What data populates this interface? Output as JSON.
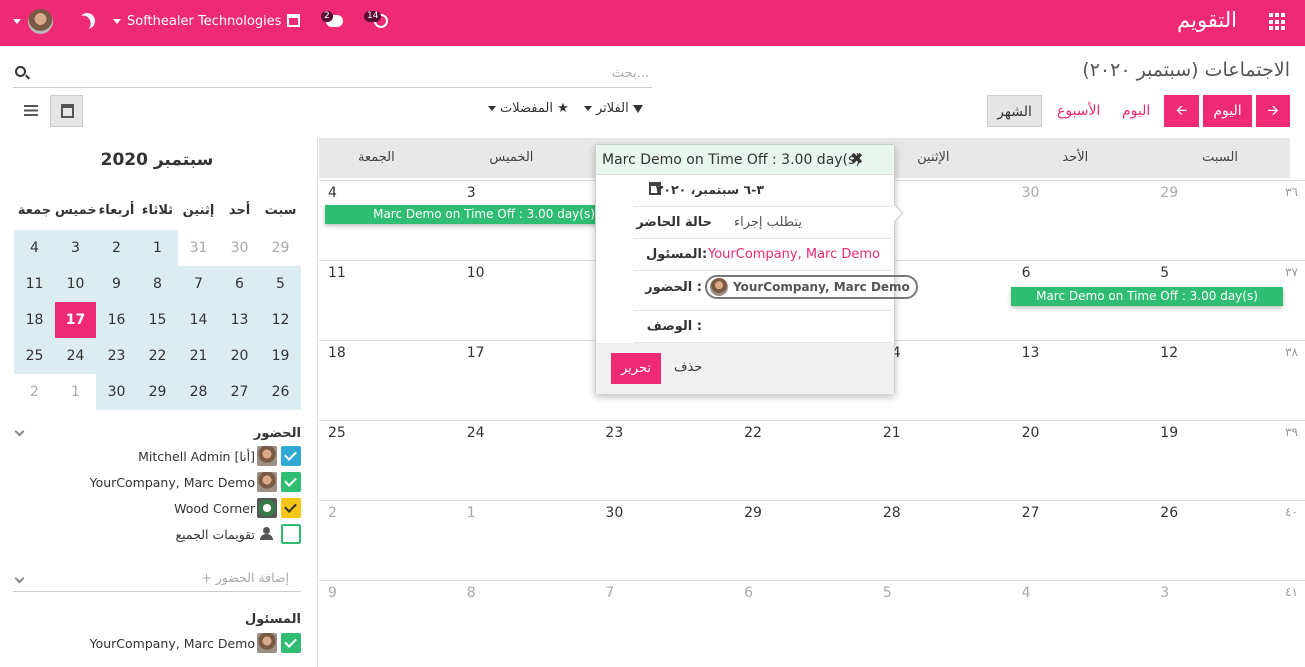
{
  "topbar": {
    "app_title": "التقويم",
    "company": "Softhealer Technologies",
    "chat_badge": "2",
    "activity_badge": "14",
    "icons": [
      "apps-grid-icon",
      "gift-icon",
      "chat-icon",
      "clock-icon",
      "moon-icon"
    ]
  },
  "breadcrumb": "الاجتماعات (سبتمبر ٢٠٢٠)",
  "search": {
    "placeholder": "بحث..."
  },
  "filters": {
    "filters_label": "الفلاتر",
    "favorites_label": "المفضلات"
  },
  "pager": {
    "today_label": "اليوم"
  },
  "scales": {
    "day": "اليوم",
    "week": "الأسبوع",
    "month": "الشهر"
  },
  "mini_calendar": {
    "title": "سبتمبر 2020",
    "weekdays": [
      "سبت",
      "أحد",
      "إثنين",
      "ثلاثاء",
      "أربعاء",
      "خميس",
      "جمعة"
    ],
    "weeks": [
      [
        "29",
        "30",
        "31",
        "1",
        "2",
        "3",
        "4"
      ],
      [
        "5",
        "6",
        "7",
        "8",
        "9",
        "10",
        "11"
      ],
      [
        "12",
        "13",
        "14",
        "15",
        "16",
        "17",
        "18"
      ],
      [
        "19",
        "20",
        "21",
        "22",
        "23",
        "24",
        "25"
      ],
      [
        "26",
        "27",
        "28",
        "29",
        "30",
        "1",
        "2"
      ]
    ],
    "today": "17"
  },
  "attendees": {
    "title": "الحضور",
    "items": [
      {
        "label": "Mitchell Admin [أنا]",
        "color": "#30a9d4"
      },
      {
        "label": "YourCompany, Marc Demo",
        "color": "#2ebd73"
      },
      {
        "label": "Wood Corner",
        "color": "#f5c518"
      },
      {
        "label": "تقويمات الجميع",
        "color": "#ffffff"
      }
    ],
    "add_placeholder": "+ إضافة الحضور"
  },
  "responsible": {
    "title": "المسئول",
    "items": [
      {
        "label": "YourCompany, Marc Demo",
        "color": "#2ebd73"
      }
    ]
  },
  "calendar": {
    "columns": [
      "السبت",
      "الأحد",
      "الإثنين",
      "الثلاثاء",
      "الأربعاء",
      "الخميس",
      "الجمعة"
    ],
    "weeks": [
      {
        "week": "٣٦",
        "days": [
          "29",
          "30",
          "1",
          "2",
          "3",
          "3",
          "4"
        ]
      },
      {
        "week": "٣٧",
        "days": [
          "5",
          "6",
          "7",
          "8",
          "9",
          "10",
          "11"
        ]
      },
      {
        "week": "٣٨",
        "days": [
          "12",
          "13",
          "14",
          "15",
          "16",
          "17",
          "18"
        ]
      },
      {
        "week": "٣٩",
        "days": [
          "19",
          "20",
          "21",
          "22",
          "23",
          "24",
          "25"
        ]
      },
      {
        "week": "٤٠",
        "days": [
          "26",
          "27",
          "28",
          "29",
          "30",
          "1",
          "2"
        ]
      },
      {
        "week": "٤١",
        "days": [
          "3",
          "4",
          "5",
          "6",
          "7",
          "8",
          "9"
        ]
      }
    ],
    "event_label": "Marc Demo on Time Off : 3.00 day(s)",
    "event_color": "#2ebd73"
  },
  "popover": {
    "title": "Marc Demo on Time Off : 3.00 day(s)",
    "date": "٣-٦ سبتمبر، ٢٠٢٠",
    "state_key": "حالة الحاضر",
    "state_val": "يتطلب إجراء",
    "responsible_key": "المسئول",
    "responsible_val": "YourCompany, Marc Demo",
    "attendees_key": "الحضور :",
    "attendee_chip": "YourCompany, Marc Demo",
    "description_key": "الوصف :",
    "edit_label": "تحرير",
    "delete_label": "حذف"
  },
  "colors": {
    "brand": "#ee2a74",
    "event": "#2ebd73",
    "mini_cal_bg": "#dcedf2"
  }
}
